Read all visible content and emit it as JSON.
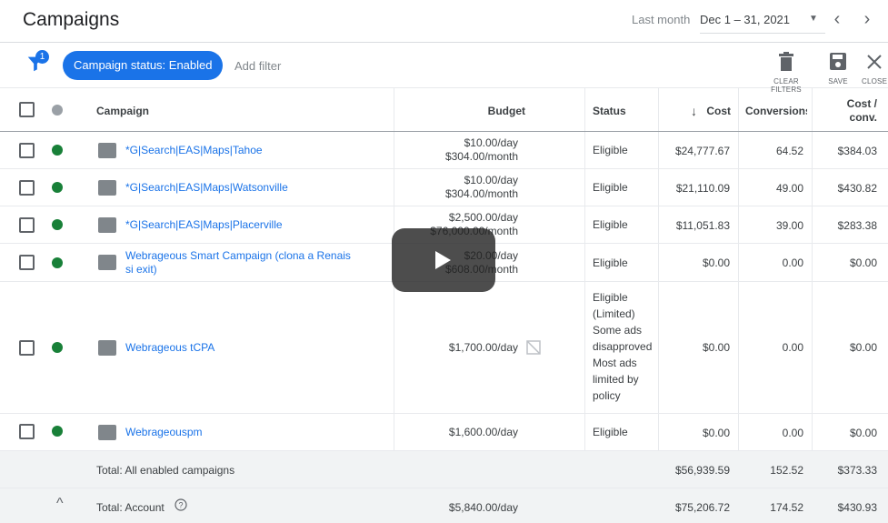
{
  "header": {
    "title": "Campaigns",
    "range_label": "Last month",
    "range_value": "Dec 1 – 31, 2021",
    "prev_icon": "chevron-left-icon",
    "next_icon": "chevron-right-icon",
    "dropdown_icon": "caret-down-icon"
  },
  "filterbar": {
    "filter_count": "1",
    "chip_label": "Campaign status: Enabled",
    "add_filter": "Add filter",
    "clear_filters": "CLEAR FILTERS",
    "save": "SAVE",
    "close": "CLOSE"
  },
  "table": {
    "columns": {
      "campaign": "Campaign",
      "budget": "Budget",
      "status": "Status",
      "cost": "Cost",
      "conversions": "Conversions",
      "cost_per_conv_1": "Cost /",
      "cost_per_conv_2": "conv."
    },
    "rows": [
      {
        "name": "*G|Search|EAS|Maps|Tahoe",
        "name2": "",
        "budget1": "$10.00/day",
        "budget2": "$304.00/month",
        "status": [
          "Eligible"
        ],
        "cost": "$24,777.67",
        "conv": "64.52",
        "cpc": "$384.03",
        "type": "smart"
      },
      {
        "name": "*G|Search|EAS|Maps|Watsonville",
        "name2": "",
        "budget1": "$10.00/day",
        "budget2": "$304.00/month",
        "status": [
          "Eligible"
        ],
        "cost": "$21,110.09",
        "conv": "49.00",
        "cpc": "$430.82",
        "type": "smart"
      },
      {
        "name": "*G|Search|EAS|Maps|Placerville",
        "name2": "",
        "budget1": "$2,500.00/day",
        "budget2": "$76,000.00/month",
        "status": [
          "Eligible"
        ],
        "cost": "$11,051.83",
        "conv": "39.00",
        "cpc": "$283.38",
        "type": "smart"
      },
      {
        "name": "Webrageous Smart Campaign (clona a Renais",
        "name2": "si exit)",
        "budget1": "$20.00/day",
        "budget2": "$608.00/month",
        "status": [
          "Eligible"
        ],
        "cost": "$0.00",
        "conv": "0.00",
        "cpc": "$0.00",
        "type": "smart"
      },
      {
        "name": "Webrageous tCPA",
        "name2": "",
        "budget1": "$1,700.00/day",
        "budget2": "",
        "status": [
          "Eligible",
          "(Limited)",
          "Some ads",
          "disapproved",
          "Most ads",
          "limited by",
          "policy"
        ],
        "cost": "$0.00",
        "conv": "0.00",
        "cpc": "$0.00",
        "type": "search"
      },
      {
        "name": "Webrageouspm",
        "name2": "",
        "budget1": "$1,600.00/day",
        "budget2": "",
        "status": [
          "Eligible"
        ],
        "cost": "$0.00",
        "conv": "0.00",
        "cpc": "$0.00",
        "type": "pmax"
      }
    ],
    "totals": [
      {
        "label": "Total: All enabled campaigns",
        "budget": "",
        "cost": "$56,939.59",
        "conv": "152.52",
        "cpc": "$373.33"
      },
      {
        "label": "Total: Account",
        "budget": "$5,840.00/day",
        "cost": "$75,206.72",
        "conv": "174.52",
        "cpc": "$430.93"
      }
    ]
  },
  "colors": {
    "accent": "#1a73e8",
    "enabled": "#188038",
    "total_bg": "#f1f3f4"
  },
  "overlay": {
    "icon": "play-icon"
  }
}
